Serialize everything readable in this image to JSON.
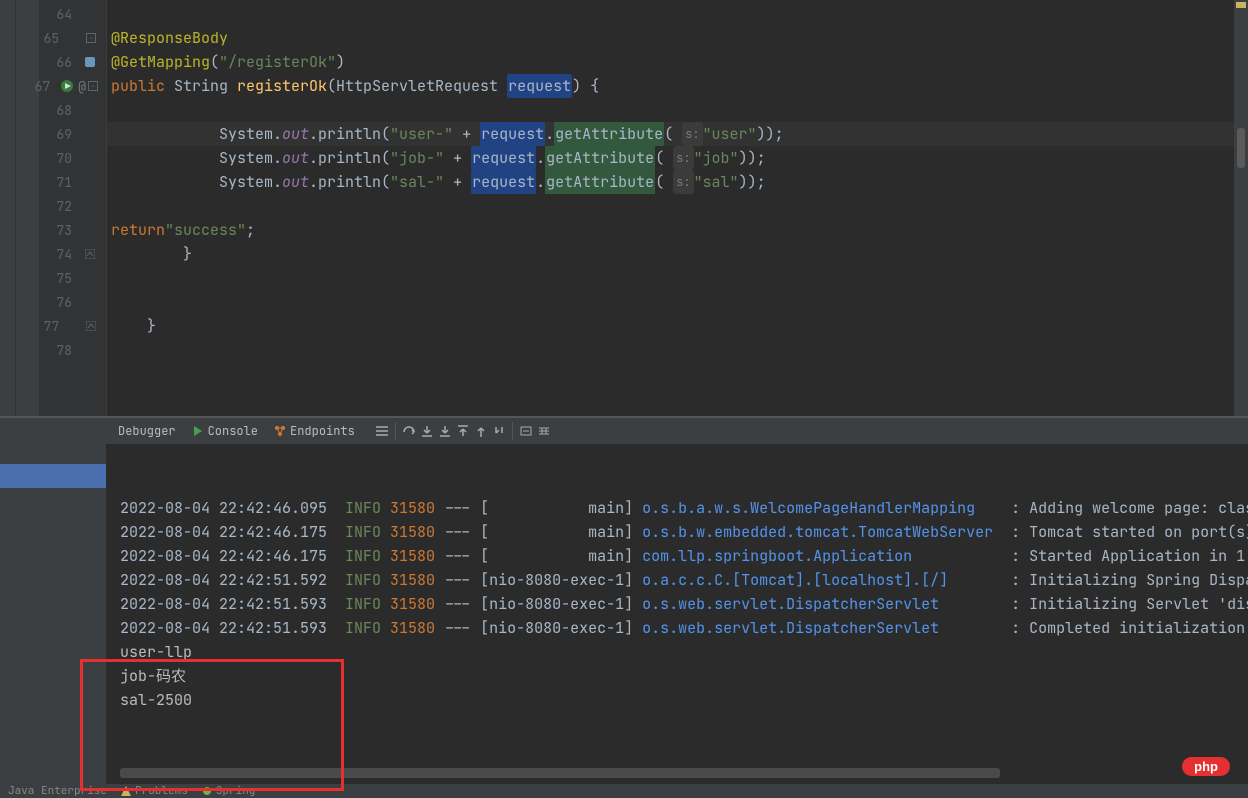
{
  "editor": {
    "lines": [
      {
        "num": "64",
        "code": ""
      },
      {
        "num": "65",
        "code": "        <ann>@ResponseBody</ann>",
        "fold": "-"
      },
      {
        "num": "66",
        "code": "        <ann>@GetMapping</ann>(<str>\"/registerOk\"</str>)",
        "icon": "bookmark"
      },
      {
        "num": "67",
        "code": "        <kw>public</kw> String <methodDecl>registerOk</methodDecl>(HttpServletRequest <span class='hl-box'>request</span>) {",
        "icon": "run-at",
        "fold": "-"
      },
      {
        "num": "68",
        "code": ""
      },
      {
        "num": "69",
        "code": "            System.<static>out</static>.println(<str>\"user-\"</str> + <span class='hl-box'>request</span>.<span class='method-hl'>getAttribute</span>( <span class='param-hint'>s:</span> <str>\"user\"</str>));",
        "hl": true
      },
      {
        "num": "70",
        "code": "            System.<static>out</static>.println(<str>\"job-\"</str> + <span class='hl-box'>request</span>.<span class='method-hl'>getAttribute</span>( <span class='param-hint'>s:</span> <str>\"job\"</str>));"
      },
      {
        "num": "71",
        "code": "            System.<static>out</static>.println(<str>\"sal-\"</str> + <span class='hl-box'>request</span>.<span class='method-hl'>getAttribute</span>( <span class='param-hint'>s:</span> <str>\"sal\"</str>));"
      },
      {
        "num": "72",
        "code": ""
      },
      {
        "num": "73",
        "code": "            <kw>return</kw> <str>\"success\"</str>;"
      },
      {
        "num": "74",
        "code": "        }",
        "icon": "fold-up"
      },
      {
        "num": "75",
        "code": ""
      },
      {
        "num": "76",
        "code": ""
      },
      {
        "num": "77",
        "code": "    }",
        "fold": "up"
      },
      {
        "num": "78",
        "code": ""
      }
    ]
  },
  "toolbar": {
    "debugger": "Debugger",
    "console": "Console",
    "endpoints": "Endpoints"
  },
  "console": {
    "lines": [
      {
        "ts": "2022-08-04 22:42:46.095",
        "lv": "INFO",
        "pid": "31580",
        "sep": "--- [",
        "thread": "           main]",
        "logger": "o.s.b.a.w.s.WelcomePageHandlerMapping    ",
        "msg": ": Adding welcome page: clas"
      },
      {
        "ts": "2022-08-04 22:42:46.175",
        "lv": "INFO",
        "pid": "31580",
        "sep": "--- [",
        "thread": "           main]",
        "logger": "o.s.b.w.embedded.tomcat.TomcatWebServer  ",
        "msg": ": Tomcat started on port(s)"
      },
      {
        "ts": "2022-08-04 22:42:46.175",
        "lv": "INFO",
        "pid": "31580",
        "sep": "--- [",
        "thread": "           main]",
        "logger": "com.llp.springboot.Application           ",
        "msg": ": Started Application in 1."
      },
      {
        "ts": "2022-08-04 22:42:51.592",
        "lv": "INFO",
        "pid": "31580",
        "sep": "--- [",
        "thread": "nio-8080-exec-1]",
        "logger": "o.a.c.c.C.[Tomcat].[localhost].[/]       ",
        "msg": ": Initializing Spring Dispa"
      },
      {
        "ts": "2022-08-04 22:42:51.593",
        "lv": "INFO",
        "pid": "31580",
        "sep": "--- [",
        "thread": "nio-8080-exec-1]",
        "logger": "o.s.web.servlet.DispatcherServlet        ",
        "msg": ": Initializing Servlet 'dis"
      },
      {
        "ts": "2022-08-04 22:42:51.593",
        "lv": "INFO",
        "pid": "31580",
        "sep": "--- [",
        "thread": "nio-8080-exec-1]",
        "logger": "o.s.web.servlet.DispatcherServlet        ",
        "msg": ": Completed initialization "
      }
    ],
    "output": [
      "user-llp",
      "job-码农",
      "sal-2500"
    ]
  },
  "statusbar": {
    "items": [
      "Java Enterprise",
      "Problems",
      "Spring"
    ]
  },
  "watermark": "php"
}
